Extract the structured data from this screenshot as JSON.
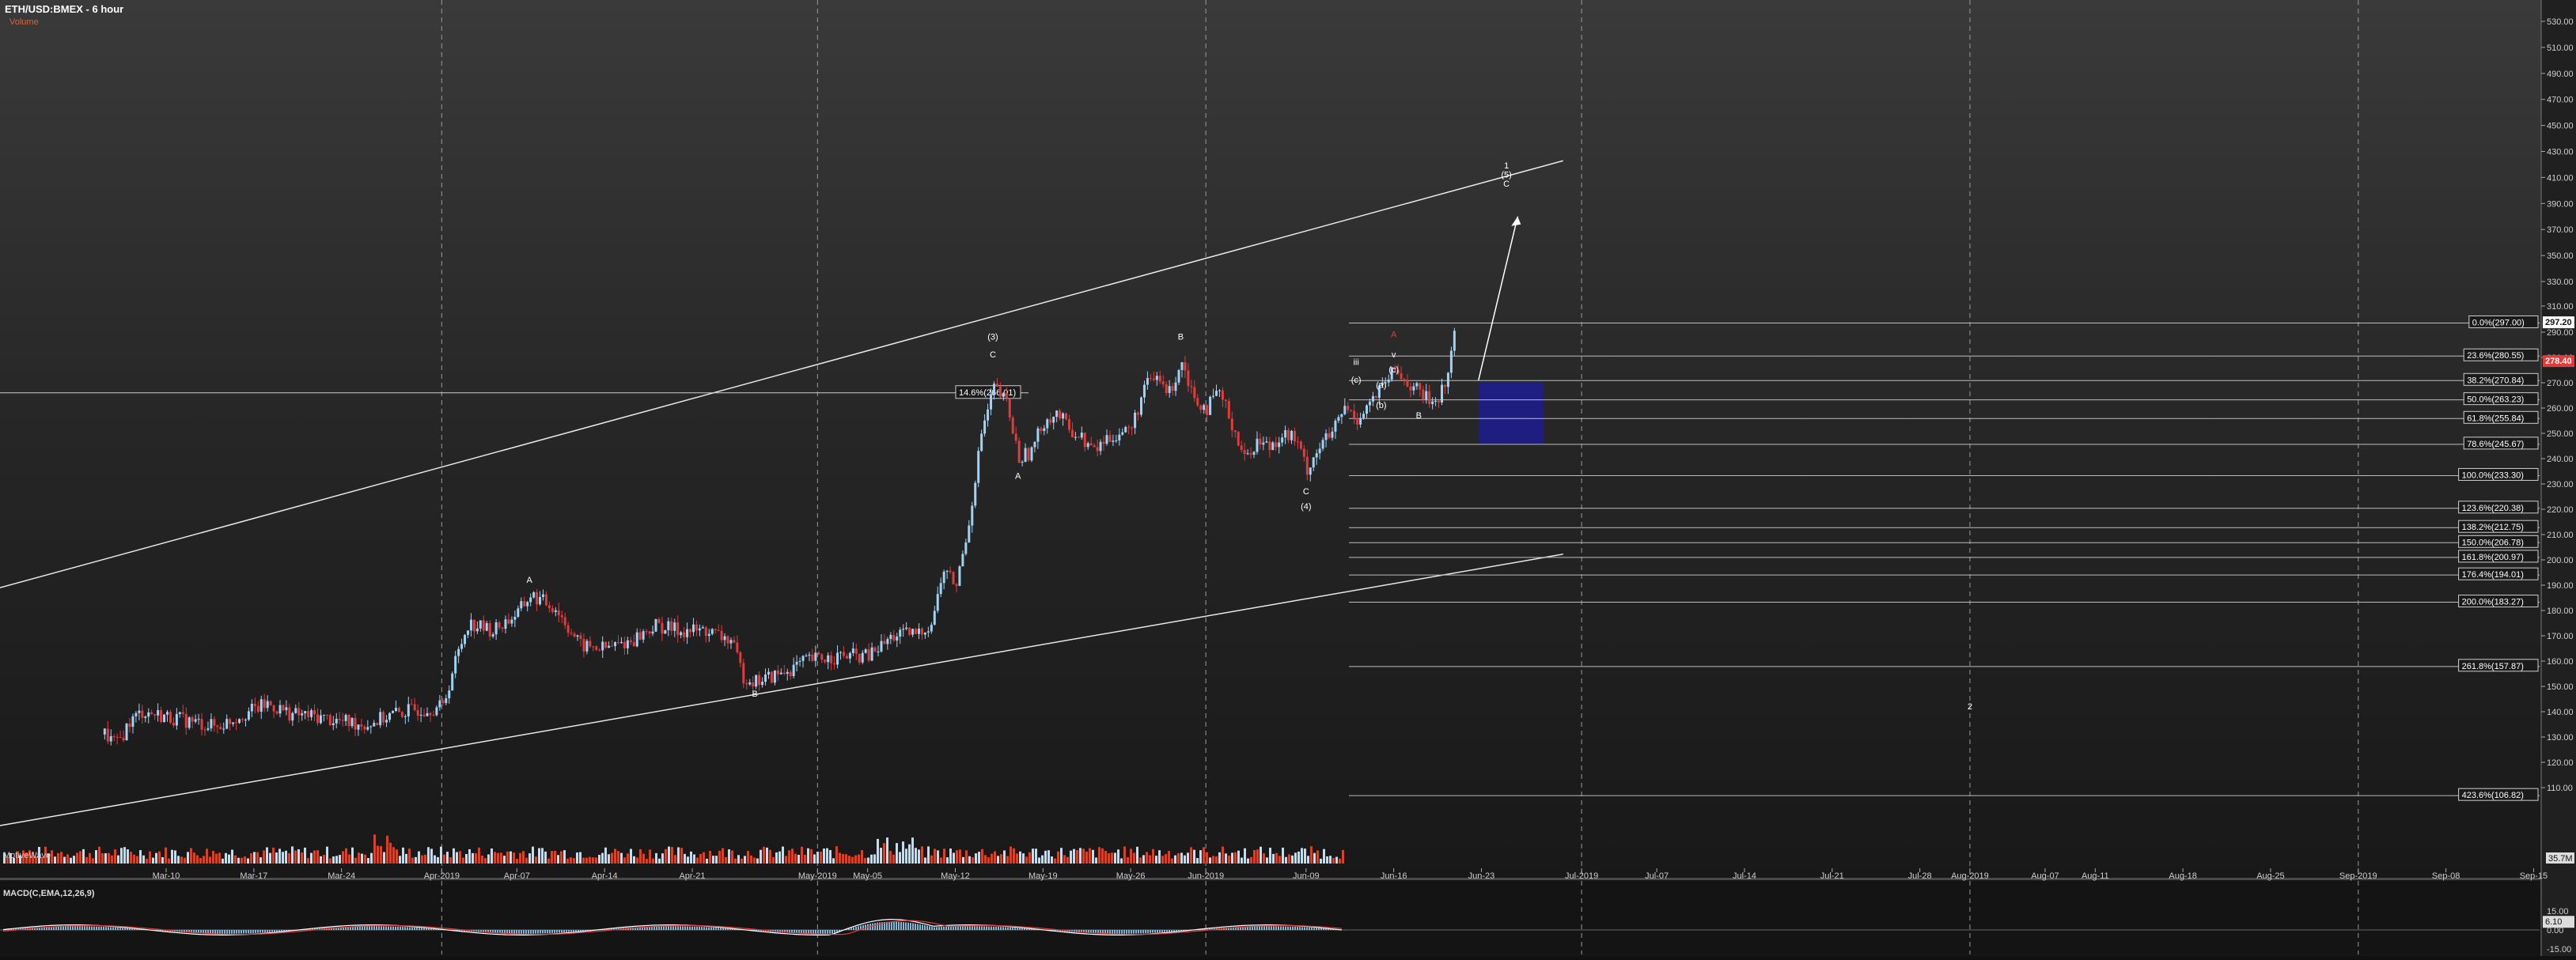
{
  "header": {
    "title": "ETH/USD:BMEX - 6 hour",
    "subtitle": "Volume"
  },
  "macd": {
    "label": "MACD(C,EMA,12,26,9)",
    "axis_ticks": [
      {
        "label": "15.00",
        "v": 15
      },
      {
        "label": "6.10",
        "v": 6.1,
        "boxed": true
      },
      {
        "label": "0.00",
        "v": 0
      },
      {
        "label": "-15.00",
        "v": -15
      }
    ]
  },
  "watermark": "MotiveWave",
  "chart_data": {
    "type": "candlestick",
    "title": "ETH/USD:BMEX - 6 hour",
    "x_tick_labels": [
      "Mar-10",
      "Mar-17",
      "Mar-24",
      "Apr-2019",
      "Apr-07",
      "Apr-14",
      "Apr-21",
      "May-2019",
      "May-05",
      "May-12",
      "May-19",
      "May-26",
      "Jun-2019",
      "Jun-09",
      "Jun-16",
      "Jun-23",
      "Jul-2019",
      "Jul-07",
      "Jul-14",
      "Jul-21",
      "Jul-28",
      "Aug-2019",
      "Aug-07",
      "Aug-11",
      "Aug-18",
      "Aug-25",
      "Sep-2019",
      "Sep-08",
      "Sep-15"
    ],
    "y_tick_labels": [
      110,
      120,
      130,
      140,
      150,
      160,
      170,
      180,
      190,
      200,
      210,
      220,
      230,
      240,
      250,
      260,
      270,
      280,
      290,
      310,
      330,
      350,
      370,
      390,
      410,
      430,
      450,
      470,
      490,
      510,
      530
    ],
    "ylim": [
      100,
      540
    ],
    "price_path": [
      [
        "2019-03-05",
        131
      ],
      [
        "2019-03-06",
        127
      ],
      [
        "2019-03-07",
        136
      ],
      [
        "2019-03-08",
        140
      ],
      [
        "2019-03-10",
        138
      ],
      [
        "2019-03-12",
        136
      ],
      [
        "2019-03-14",
        134
      ],
      [
        "2019-03-16",
        139
      ],
      [
        "2019-03-18",
        143
      ],
      [
        "2019-03-20",
        139
      ],
      [
        "2019-03-22",
        138
      ],
      [
        "2019-03-24",
        136
      ],
      [
        "2019-03-26",
        135
      ],
      [
        "2019-03-28",
        139
      ],
      [
        "2019-03-30",
        141
      ],
      [
        "2019-04-01",
        142
      ],
      [
        "2019-04-02",
        160
      ],
      [
        "2019-04-03",
        175
      ],
      [
        "2019-04-05",
        172
      ],
      [
        "2019-04-07",
        179
      ],
      [
        "2019-04-08",
        186
      ],
      [
        "2019-04-10",
        181
      ],
      [
        "2019-04-12",
        166
      ],
      [
        "2019-04-14",
        165
      ],
      [
        "2019-04-16",
        168
      ],
      [
        "2019-04-18",
        174
      ],
      [
        "2019-04-20",
        172
      ],
      [
        "2019-04-22",
        172
      ],
      [
        "2019-04-24",
        168
      ],
      [
        "2019-04-25",
        154
      ],
      [
        "2019-04-26",
        152
      ],
      [
        "2019-04-28",
        155
      ],
      [
        "2019-04-30",
        160
      ],
      [
        "2019-05-01",
        161
      ],
      [
        "2019-05-03",
        162
      ],
      [
        "2019-05-05",
        162
      ],
      [
        "2019-05-07",
        170
      ],
      [
        "2019-05-09",
        171
      ],
      [
        "2019-05-10",
        175
      ],
      [
        "2019-05-11",
        196
      ],
      [
        "2019-05-12",
        190
      ],
      [
        "2019-05-13",
        215
      ],
      [
        "2019-05-14",
        250
      ],
      [
        "2019-05-15",
        268
      ],
      [
        "2019-05-16",
        262
      ],
      [
        "2019-05-17",
        240
      ],
      [
        "2019-05-18",
        243
      ],
      [
        "2019-05-19",
        255
      ],
      [
        "2019-05-20",
        258
      ],
      [
        "2019-05-21",
        252
      ],
      [
        "2019-05-22",
        248
      ],
      [
        "2019-05-23",
        243
      ],
      [
        "2019-05-24",
        248
      ],
      [
        "2019-05-25",
        250
      ],
      [
        "2019-05-26",
        252
      ],
      [
        "2019-05-27",
        268
      ],
      [
        "2019-05-28",
        272
      ],
      [
        "2019-05-29",
        266
      ],
      [
        "2019-05-30",
        279
      ],
      [
        "2019-05-31",
        264
      ],
      [
        "2019-06-01",
        260
      ],
      [
        "2019-06-02",
        266
      ],
      [
        "2019-06-03",
        254
      ],
      [
        "2019-06-04",
        240
      ],
      [
        "2019-06-05",
        247
      ],
      [
        "2019-06-06",
        245
      ],
      [
        "2019-06-07",
        250
      ],
      [
        "2019-06-08",
        248
      ],
      [
        "2019-06-09",
        236
      ],
      [
        "2019-06-10",
        245
      ],
      [
        "2019-06-11",
        250
      ],
      [
        "2019-06-12",
        260
      ],
      [
        "2019-06-13",
        256
      ],
      [
        "2019-06-14",
        262
      ],
      [
        "2019-06-15",
        268
      ],
      [
        "2019-06-16",
        275
      ],
      [
        "2019-06-17",
        270
      ],
      [
        "2019-06-18",
        266
      ],
      [
        "2019-06-19",
        262
      ],
      [
        "2019-06-20",
        268
      ],
      [
        "2019-06-21",
        297
      ]
    ],
    "fib_levels": [
      {
        "label": "0.0%(297.00)",
        "value": 297.0
      },
      {
        "label": "23.6%(280.55)",
        "value": 280.55
      },
      {
        "label": "38.2%(270.84)",
        "value": 270.84
      },
      {
        "label": "50.0%(263.23)",
        "value": 263.23
      },
      {
        "label": "61.8%(255.84)",
        "value": 255.84
      },
      {
        "label": "78.6%(245.67)",
        "value": 245.67
      },
      {
        "label": "100.0%(233.30)",
        "value": 233.3
      },
      {
        "label": "123.6%(220.38)",
        "value": 220.38
      },
      {
        "label": "138.2%(212.75)",
        "value": 212.75
      },
      {
        "label": "150.0%(206.78)",
        "value": 206.78
      },
      {
        "label": "161.8%(200.97)",
        "value": 200.97
      },
      {
        "label": "176.4%(194.01)",
        "value": 194.01
      },
      {
        "label": "200.0%(183.27)",
        "value": 183.27
      },
      {
        "label": "261.8%(157.87)",
        "value": 157.87
      },
      {
        "label": "423.6%(106.82)",
        "value": 106.82
      }
    ],
    "fib_hline": {
      "label": "14.6%(266.01)",
      "value": 266.01
    },
    "price_badges": [
      {
        "label": "297.20",
        "value": 297.2,
        "color": "#ffffff"
      },
      {
        "label": "278.40",
        "value": 278.4,
        "color": "#e23b3b"
      }
    ],
    "volume_badge": "35.7M",
    "channel_upper": [
      [
        "2019-02-28",
        189
      ],
      [
        "2019-06-27",
        418
      ]
    ],
    "channel_lower": [
      [
        "2019-02-28",
        95
      ],
      [
        "2019-06-27",
        201
      ]
    ],
    "target_box": {
      "from": "2019-06-21",
      "to": "2019-06-24",
      "low": 246,
      "high": 270,
      "color": "#1e1e8c"
    },
    "projection_arrow": [
      [
        "2019-06-21",
        271
      ],
      [
        "2019-06-24",
        380
      ]
    ],
    "wave_labels": [
      {
        "t": "A",
        "date": "2019-04-08",
        "v": 191,
        "color": "#ffffff"
      },
      {
        "t": "B",
        "date": "2019-04-26",
        "v": 146,
        "color": "#ffffff"
      },
      {
        "t": "(3)",
        "date": "2019-05-15",
        "v": 287,
        "color": "#ffffff"
      },
      {
        "t": "C",
        "date": "2019-05-15",
        "v": 280,
        "color": "#ffffff"
      },
      {
        "t": "A",
        "date": "2019-05-17",
        "v": 232,
        "color": "#ffffff"
      },
      {
        "t": "B",
        "date": "2019-05-30",
        "v": 287,
        "color": "#ffffff"
      },
      {
        "t": "C",
        "date": "2019-06-09",
        "v": 226,
        "color": "#ffffff"
      },
      {
        "t": "(4)",
        "date": "2019-06-09",
        "v": 220,
        "color": "#ffffff"
      },
      {
        "t": "A",
        "date": "2019-06-16",
        "v": 288,
        "color": "#e23b3b"
      },
      {
        "t": "B",
        "date": "2019-06-18",
        "v": 256,
        "color": "#ffffff"
      },
      {
        "t": "iii",
        "date": "2019-06-13",
        "v": 277,
        "color": "#ffffff"
      },
      {
        "t": "(c)",
        "date": "2019-06-13",
        "v": 270,
        "color": "#ffffff"
      },
      {
        "t": "v",
        "date": "2019-06-16",
        "v": 280,
        "color": "#ffffff"
      },
      {
        "t": "(c)",
        "date": "2019-06-16",
        "v": 274,
        "color": "#ffffff"
      },
      {
        "t": "(b)",
        "date": "2019-06-15",
        "v": 260,
        "color": "#ffffff"
      },
      {
        "t": "(a)",
        "date": "2019-06-15",
        "v": 268,
        "color": "#ffffff"
      },
      {
        "t": "1",
        "date": "2019-06-25",
        "v": 417,
        "color": "#ffffff"
      },
      {
        "t": "(5)",
        "date": "2019-06-25",
        "v": 410,
        "color": "#ffffff"
      },
      {
        "t": "C",
        "date": "2019-06-25",
        "v": 403,
        "color": "#ffffff"
      },
      {
        "t": "2",
        "date": "2019-08-01",
        "v": 141,
        "color": "#ffffff"
      }
    ],
    "macd_series": "oscillates around 0 through the period, positive spike near May-14, rising at the last bar to 6.10"
  }
}
